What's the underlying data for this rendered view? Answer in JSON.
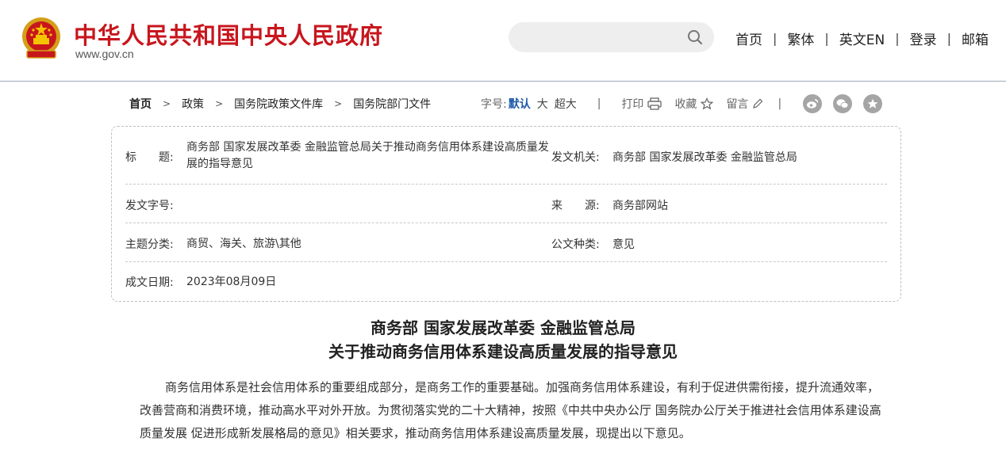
{
  "header": {
    "site_title": "中华人民共和国中央人民政府",
    "site_url": "www.gov.cn",
    "search": {
      "placeholder": "",
      "value": ""
    },
    "nav": [
      "首页",
      "繁体",
      "英文EN",
      "登录",
      "邮箱"
    ],
    "nav_separator": "|",
    "brand_color": "#c8161d"
  },
  "breadcrumb": {
    "items": [
      "首页",
      "政策",
      "国务院政策文件库",
      "国务院部门文件"
    ],
    "separator": ">"
  },
  "toolbar": {
    "font_size_label": "字号:",
    "font_default": "默认",
    "font_large": "大",
    "font_xlarge": "超大",
    "separator": "|",
    "print_label": "打印",
    "favorite_label": "收藏",
    "comment_label": "留言",
    "active_color": "#1e5aa8"
  },
  "info": {
    "title_label": "标　　题:",
    "title_value": "商务部 国家发展改革委 金融监管总局关于推动商务信用体系建设高质量发展的指导意见",
    "issuer_label": "发文机关:",
    "issuer_value": "商务部 国家发展改革委 金融监管总局",
    "doc_no_label": "发文字号:",
    "doc_no_value": "",
    "source_label": "来　　源:",
    "source_value": "商务部网站",
    "topic_label": "主题分类:",
    "topic_value": "商贸、海关、旅游\\其他",
    "doc_type_label": "公文种类:",
    "doc_type_value": "意见",
    "date_label": "成文日期:",
    "date_value": "2023年08月09日"
  },
  "article": {
    "title_line1": "商务部 国家发展改革委 金融监管总局",
    "title_line2": "关于推动商务信用体系建设高质量发展的指导意见",
    "paragraph1": "商务信用体系是社会信用体系的重要组成部分，是商务工作的重要基础。加强商务信用体系建设，有利于促进供需衔接，提升流通效率，改善营商和消费环境，推动高水平对外开放。为贯彻落实党的二十大精神，按照《中共中央办公厅 国务院办公厅关于推进社会信用体系建设高质量发展 促进形成新发展格局的意见》相关要求，推动商务信用体系建设高质量发展，现提出以下意见。"
  }
}
